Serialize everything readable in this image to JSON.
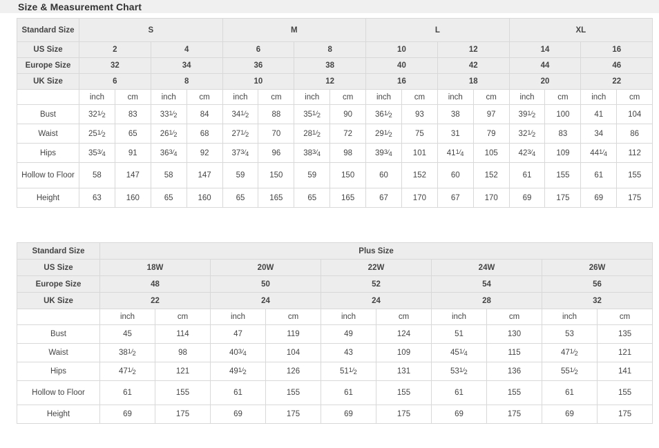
{
  "page": {
    "title": "Size & Measurement Chart"
  },
  "colors": {
    "banner_bg": "#f0f0f0",
    "header_bg": "#ededed",
    "border": "#d8d8d8",
    "text": "#444444"
  },
  "table_standard": {
    "corner_label": "Standard Size",
    "groups": [
      {
        "label": "S",
        "columns": 2
      },
      {
        "label": "M",
        "columns": 2
      },
      {
        "label": "L",
        "columns": 2
      },
      {
        "label": "XL",
        "columns": 2
      }
    ],
    "size_rows": [
      {
        "label": "US Size",
        "values": [
          "2",
          "4",
          "6",
          "8",
          "10",
          "12",
          "14",
          "16"
        ]
      },
      {
        "label": "Europe Size",
        "values": [
          "32",
          "34",
          "36",
          "38",
          "40",
          "42",
          "44",
          "46"
        ]
      },
      {
        "label": "UK Size",
        "values": [
          "6",
          "8",
          "10",
          "12",
          "16",
          "18",
          "20",
          "22"
        ]
      }
    ],
    "unit_row": {
      "label": "",
      "units": [
        "inch",
        "cm",
        "inch",
        "cm",
        "inch",
        "cm",
        "inch",
        "cm",
        "inch",
        "cm",
        "inch",
        "cm",
        "inch",
        "cm",
        "inch",
        "cm"
      ]
    },
    "measurement_rows": [
      {
        "label": "Bust",
        "cells": [
          {
            "whole": "32",
            "num": "1",
            "den": "2"
          },
          {
            "whole": "83"
          },
          {
            "whole": "33",
            "num": "1",
            "den": "2"
          },
          {
            "whole": "84"
          },
          {
            "whole": "34",
            "num": "1",
            "den": "2"
          },
          {
            "whole": "88"
          },
          {
            "whole": "35",
            "num": "1",
            "den": "2"
          },
          {
            "whole": "90"
          },
          {
            "whole": "36",
            "num": "1",
            "den": "2"
          },
          {
            "whole": "93"
          },
          {
            "whole": "38"
          },
          {
            "whole": "97"
          },
          {
            "whole": "39",
            "num": "1",
            "den": "2"
          },
          {
            "whole": "100"
          },
          {
            "whole": "41"
          },
          {
            "whole": "104"
          }
        ]
      },
      {
        "label": "Waist",
        "cells": [
          {
            "whole": "25",
            "num": "1",
            "den": "2"
          },
          {
            "whole": "65"
          },
          {
            "whole": "26",
            "num": "1",
            "den": "2"
          },
          {
            "whole": "68"
          },
          {
            "whole": "27",
            "num": "1",
            "den": "2"
          },
          {
            "whole": "70"
          },
          {
            "whole": "28",
            "num": "1",
            "den": "2"
          },
          {
            "whole": "72"
          },
          {
            "whole": "29",
            "num": "1",
            "den": "2"
          },
          {
            "whole": "75"
          },
          {
            "whole": "31"
          },
          {
            "whole": "79"
          },
          {
            "whole": "32",
            "num": "1",
            "den": "2"
          },
          {
            "whole": "83"
          },
          {
            "whole": "34"
          },
          {
            "whole": "86"
          }
        ]
      },
      {
        "label": "Hips",
        "cells": [
          {
            "whole": "35",
            "num": "3",
            "den": "4"
          },
          {
            "whole": "91"
          },
          {
            "whole": "36",
            "num": "3",
            "den": "4"
          },
          {
            "whole": "92"
          },
          {
            "whole": "37",
            "num": "3",
            "den": "4"
          },
          {
            "whole": "96"
          },
          {
            "whole": "38",
            "num": "3",
            "den": "4"
          },
          {
            "whole": "98"
          },
          {
            "whole": "39",
            "num": "3",
            "den": "4"
          },
          {
            "whole": "101"
          },
          {
            "whole": "41",
            "num": "1",
            "den": "4"
          },
          {
            "whole": "105"
          },
          {
            "whole": "42",
            "num": "3",
            "den": "4"
          },
          {
            "whole": "109"
          },
          {
            "whole": "44",
            "num": "1",
            "den": "4"
          },
          {
            "whole": "112"
          }
        ]
      },
      {
        "label": "Hollow to Floor",
        "tall": true,
        "cells": [
          {
            "whole": "58"
          },
          {
            "whole": "147"
          },
          {
            "whole": "58"
          },
          {
            "whole": "147"
          },
          {
            "whole": "59"
          },
          {
            "whole": "150"
          },
          {
            "whole": "59"
          },
          {
            "whole": "150"
          },
          {
            "whole": "60"
          },
          {
            "whole": "152"
          },
          {
            "whole": "60"
          },
          {
            "whole": "152"
          },
          {
            "whole": "61"
          },
          {
            "whole": "155"
          },
          {
            "whole": "61"
          },
          {
            "whole": "155"
          }
        ]
      },
      {
        "label": "Height",
        "cells": [
          {
            "whole": "63"
          },
          {
            "whole": "160"
          },
          {
            "whole": "65"
          },
          {
            "whole": "160"
          },
          {
            "whole": "65"
          },
          {
            "whole": "165"
          },
          {
            "whole": "65"
          },
          {
            "whole": "165"
          },
          {
            "whole": "67"
          },
          {
            "whole": "170"
          },
          {
            "whole": "67"
          },
          {
            "whole": "170"
          },
          {
            "whole": "69"
          },
          {
            "whole": "175"
          },
          {
            "whole": "69"
          },
          {
            "whole": "175"
          }
        ]
      }
    ]
  },
  "table_plus": {
    "corner_label": "Standard Size",
    "group_label": "Plus Size",
    "size_rows": [
      {
        "label": "US Size",
        "values": [
          "18W",
          "20W",
          "22W",
          "24W",
          "26W"
        ]
      },
      {
        "label": "Europe Size",
        "values": [
          "48",
          "50",
          "52",
          "54",
          "56"
        ]
      },
      {
        "label": "UK Size",
        "values": [
          "22",
          "24",
          "24",
          "28",
          "32"
        ]
      }
    ],
    "unit_row": {
      "label": "",
      "units": [
        "inch",
        "cm",
        "inch",
        "cm",
        "inch",
        "cm",
        "inch",
        "cm",
        "inch",
        "cm"
      ]
    },
    "measurement_rows": [
      {
        "label": "Bust",
        "cells": [
          {
            "whole": "45"
          },
          {
            "whole": "114"
          },
          {
            "whole": "47"
          },
          {
            "whole": "119"
          },
          {
            "whole": "49"
          },
          {
            "whole": "124"
          },
          {
            "whole": "51"
          },
          {
            "whole": "130"
          },
          {
            "whole": "53"
          },
          {
            "whole": "135"
          }
        ]
      },
      {
        "label": "Waist",
        "cells": [
          {
            "whole": "38",
            "num": "1",
            "den": "2"
          },
          {
            "whole": "98"
          },
          {
            "whole": "40",
            "num": "3",
            "den": "4"
          },
          {
            "whole": "104"
          },
          {
            "whole": "43"
          },
          {
            "whole": "109"
          },
          {
            "whole": "45",
            "num": "1",
            "den": "4"
          },
          {
            "whole": "115"
          },
          {
            "whole": "47",
            "num": "1",
            "den": "2"
          },
          {
            "whole": "121"
          }
        ]
      },
      {
        "label": "Hips",
        "cells": [
          {
            "whole": "47",
            "num": "1",
            "den": "2"
          },
          {
            "whole": "121"
          },
          {
            "whole": "49",
            "num": "1",
            "den": "2"
          },
          {
            "whole": "126"
          },
          {
            "whole": "51",
            "num": "1",
            "den": "2"
          },
          {
            "whole": "131"
          },
          {
            "whole": "53",
            "num": "1",
            "den": "2"
          },
          {
            "whole": "136"
          },
          {
            "whole": "55",
            "num": "1",
            "den": "2"
          },
          {
            "whole": "141"
          }
        ]
      },
      {
        "label": "Hollow to Floor",
        "tall": true,
        "cells": [
          {
            "whole": "61"
          },
          {
            "whole": "155"
          },
          {
            "whole": "61"
          },
          {
            "whole": "155"
          },
          {
            "whole": "61"
          },
          {
            "whole": "155"
          },
          {
            "whole": "61"
          },
          {
            "whole": "155"
          },
          {
            "whole": "61"
          },
          {
            "whole": "155"
          }
        ]
      },
      {
        "label": "Height",
        "cells": [
          {
            "whole": "69"
          },
          {
            "whole": "175"
          },
          {
            "whole": "69"
          },
          {
            "whole": "175"
          },
          {
            "whole": "69"
          },
          {
            "whole": "175"
          },
          {
            "whole": "69"
          },
          {
            "whole": "175"
          },
          {
            "whole": "69"
          },
          {
            "whole": "175"
          }
        ]
      }
    ]
  }
}
